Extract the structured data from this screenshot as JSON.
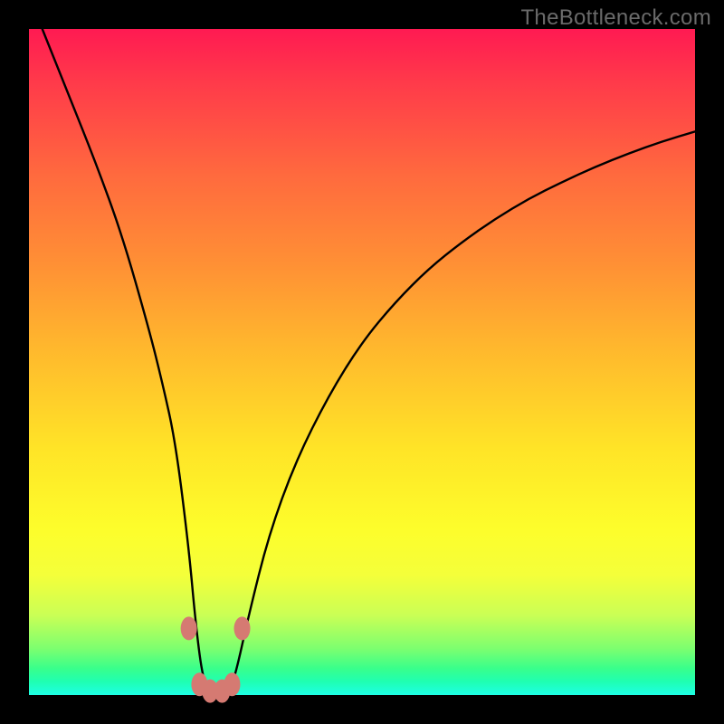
{
  "watermark": "TheBottleneck.com",
  "colors": {
    "frame": "#000000",
    "curve": "#000000",
    "marker_fill": "#d57a72",
    "marker_stroke": "#b55a54",
    "gradient_top": "#ff1a52",
    "gradient_bottom": "#1effe6"
  },
  "chart_data": {
    "type": "line",
    "title": "",
    "xlabel": "",
    "ylabel": "",
    "xlim": [
      0,
      100
    ],
    "ylim": [
      0,
      100
    ],
    "grid": false,
    "notes": "V-shaped bottleneck curve. Minimum (≈0) occurs around x≈26–30. Left branch is nearly vertical; right branch rises with decreasing slope toward upper right.",
    "series": [
      {
        "name": "bottleneck-curve",
        "x": [
          2,
          6,
          10,
          14,
          18,
          20,
          22,
          24,
          25,
          26,
          27,
          28,
          29,
          30,
          31,
          33,
          36,
          40,
          45,
          50,
          55,
          60,
          65,
          70,
          75,
          80,
          85,
          90,
          95,
          100
        ],
        "values": [
          100,
          90,
          80,
          69,
          55,
          47,
          38,
          22,
          11,
          3,
          0.5,
          0,
          0,
          0.5,
          3,
          12,
          24,
          35,
          45,
          53,
          59,
          64,
          68,
          71.5,
          74.5,
          77,
          79.3,
          81.3,
          83.1,
          84.6
        ]
      }
    ],
    "markers": [
      {
        "x": 24.0,
        "y": 10.0
      },
      {
        "x": 25.6,
        "y": 1.6
      },
      {
        "x": 27.2,
        "y": 0.6
      },
      {
        "x": 29.0,
        "y": 0.6
      },
      {
        "x": 30.5,
        "y": 1.6
      },
      {
        "x": 32.0,
        "y": 10.0
      }
    ]
  }
}
